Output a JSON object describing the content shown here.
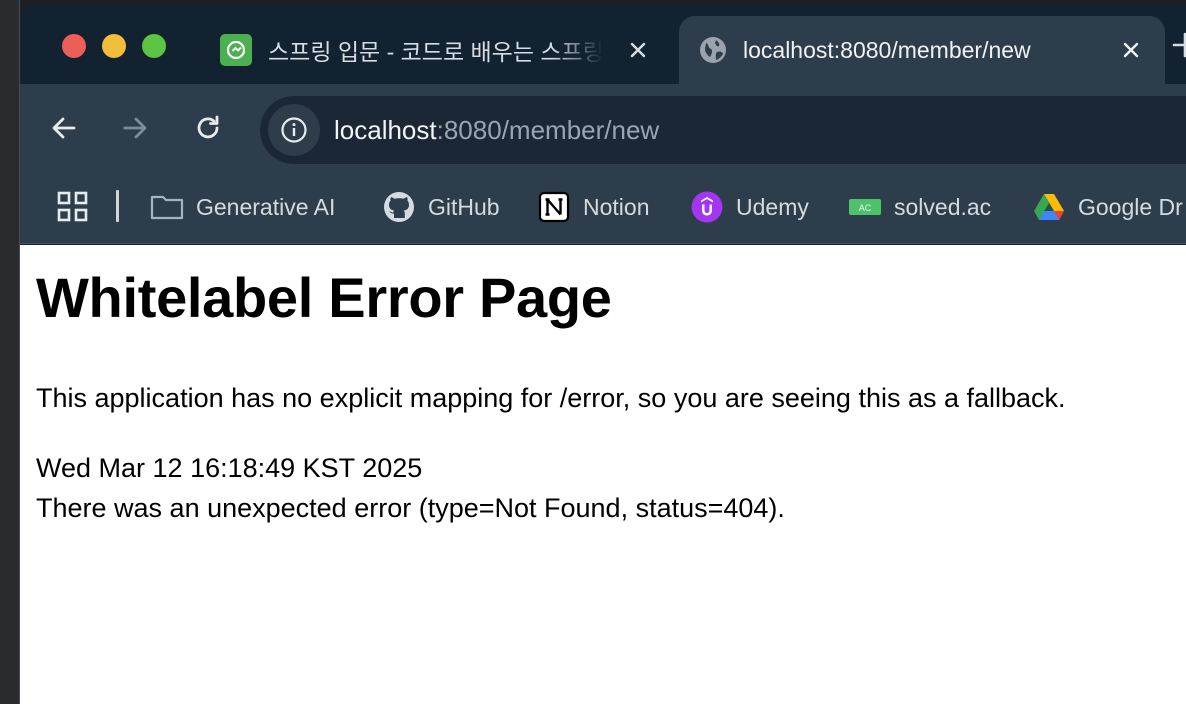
{
  "tabs": [
    {
      "title": "스프링 입문 - 코드로 배우는 스프링",
      "favicon": "inflearn-icon",
      "active": false
    },
    {
      "title": "localhost:8080/member/new",
      "favicon": "globe-icon",
      "active": true
    }
  ],
  "address_bar": {
    "host": "localhost",
    "path": ":8080/member/new"
  },
  "bookmarks": [
    {
      "label": "Generative AI",
      "icon": "folder-icon"
    },
    {
      "label": "GitHub",
      "icon": "github-icon"
    },
    {
      "label": "Notion",
      "icon": "notion-icon"
    },
    {
      "label": "Udemy",
      "icon": "udemy-icon"
    },
    {
      "label": "solved.ac",
      "icon": "solved-ac-icon"
    },
    {
      "label": "Google Dr",
      "icon": "google-drive-icon"
    }
  ],
  "page": {
    "title": "Whitelabel Error Page",
    "description": "This application has no explicit mapping for /error, so you are seeing this as a fallback.",
    "timestamp": "Wed Mar 12 16:18:49 KST 2025",
    "error": "There was an unexpected error (type=Not Found, status=404)."
  },
  "colors": {
    "tab_strip": "#132231",
    "toolbar": "#2e3d4b",
    "omnibox": "#1b2734"
  }
}
